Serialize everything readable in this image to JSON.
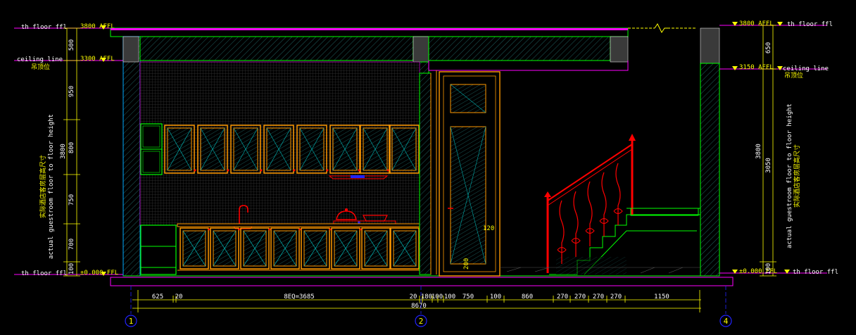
{
  "levels": {
    "floor_top_label": "th floor ffl",
    "floor_top_label_left": "th floor ffl",
    "top_mark_left": "3800 AFFL",
    "top_mark_right": "3800 AFFL",
    "ceiling_label": "ceiling line",
    "ceiling_sub": "吊顶位",
    "ceiling_mark_left": "3300 AFFL",
    "ceiling_mark_right": "3150 AFFL",
    "bottom_mark_left": "±0.000 FFL",
    "bottom_mark_right": "±0.000 FFL",
    "floor_bottom_label": "th floor ffl"
  },
  "left_dims": [
    "500",
    "950",
    "800",
    "750",
    "700",
    "100"
  ],
  "left_total": "3800",
  "right_dims": [
    "650",
    "3050",
    "100"
  ],
  "right_total": "3800",
  "vertical_note_en": "actual guestroom floor to floor height",
  "vertical_note_cn": "实际酒店客房层高尺寸",
  "bottom_dims": [
    "625",
    "20",
    "8EQ=3685",
    "20",
    "180",
    "100",
    "100",
    "750",
    "100",
    "860",
    "270",
    "270",
    "270",
    "270",
    "1150"
  ],
  "bottom_total": "8670",
  "callouts": [
    "120",
    "200"
  ],
  "grid_axes": [
    "1",
    "2",
    "4"
  ],
  "colors": {
    "background": "#000000",
    "yellow": "#ffff00",
    "green": "#00ff00",
    "red": "#ff0000",
    "magenta": "#ff00ff",
    "orange": "#ff9900",
    "cyan": "#00cccc",
    "blue": "#2222ff"
  }
}
